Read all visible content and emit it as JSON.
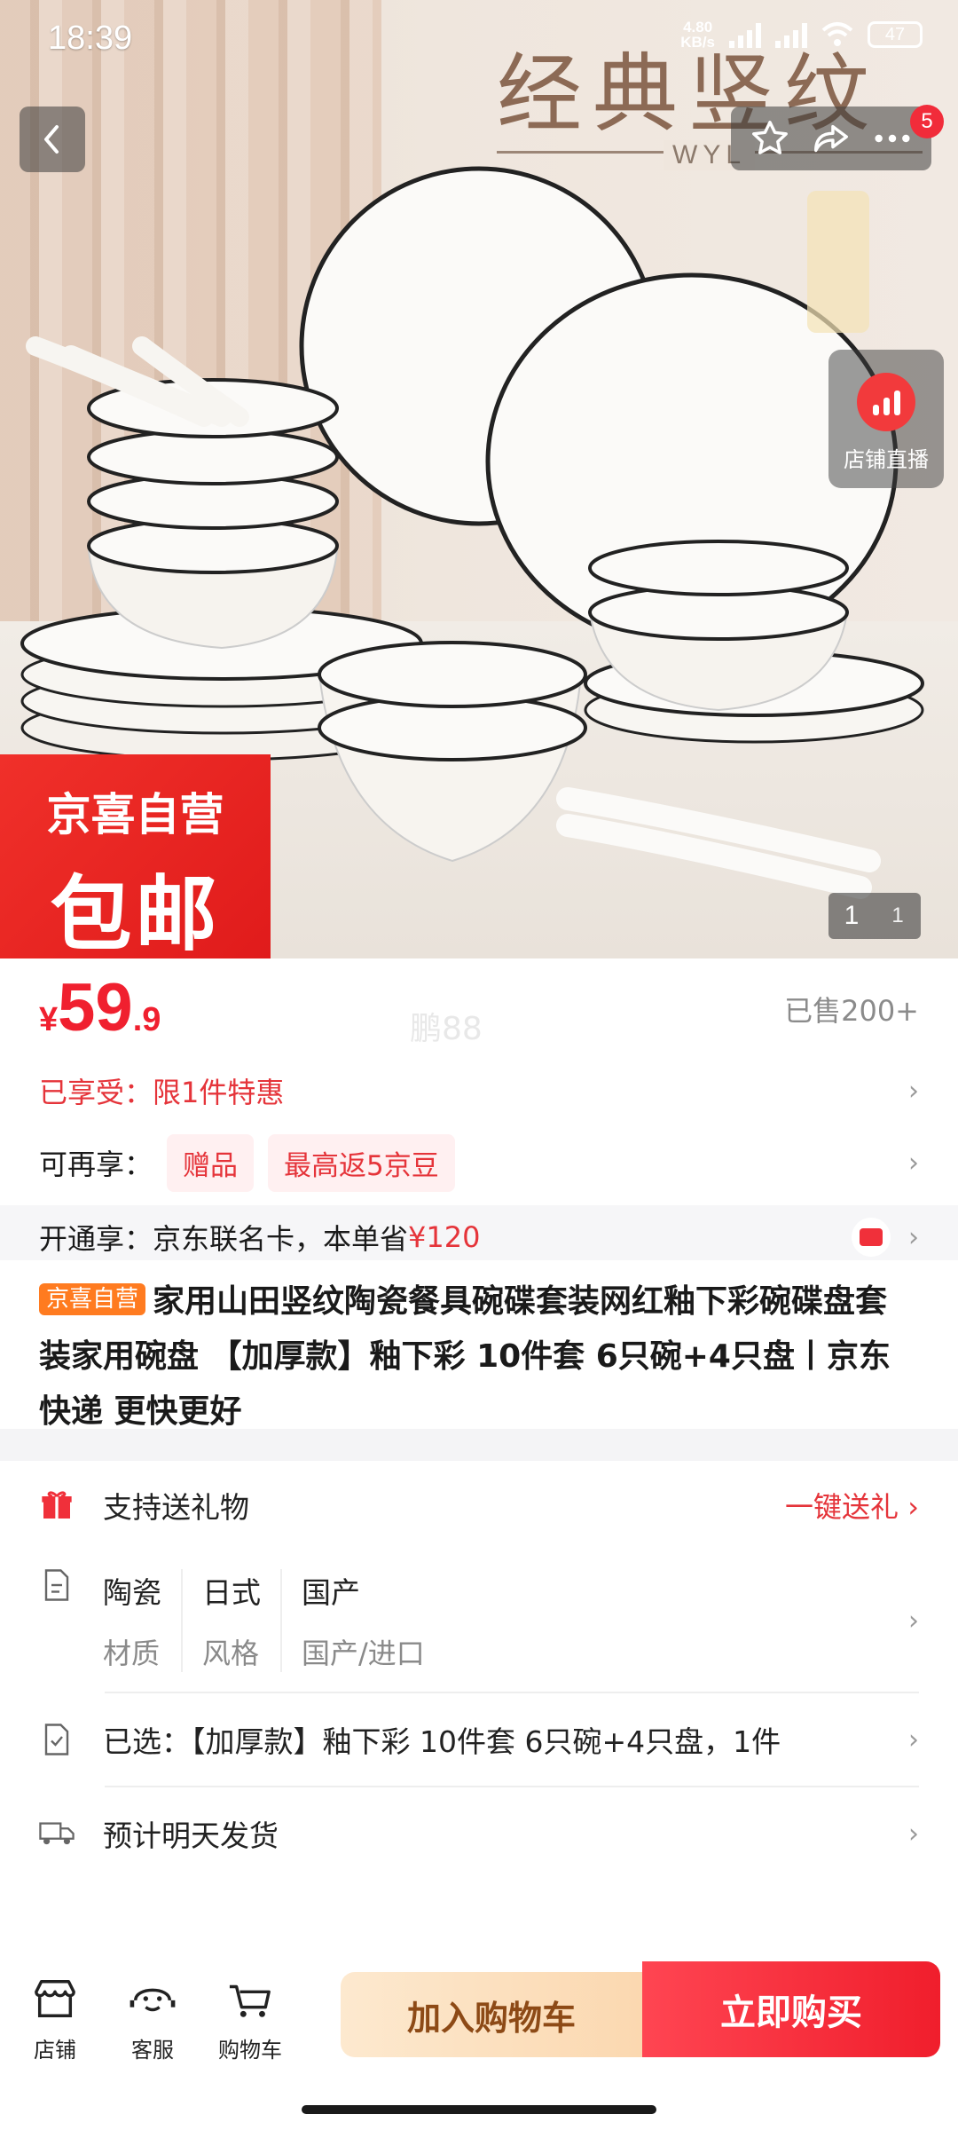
{
  "status_bar": {
    "time": "18:39",
    "net_speed": "4.80",
    "net_unit": "KB/s",
    "battery": "47"
  },
  "hero": {
    "headline": "经典竖纹",
    "subline": "WYL",
    "promo_top": "京喜自营",
    "promo_main": "包邮",
    "live_label": "店铺直播",
    "counter_current": "1",
    "counter_total": "1",
    "notif_count": "5"
  },
  "price": {
    "currency": "¥",
    "integer": "59",
    "decimal": ".9",
    "sold": "已售200+",
    "watermark": "鹏88"
  },
  "offers": {
    "enjoyed_label": "已享受：",
    "enjoyed_value": "限1件特惠",
    "more_label": "可再享：",
    "tags": [
      "赠品",
      "最高返5京豆"
    ],
    "open_label": "开通享：",
    "open_text": "京东联名卡，本单省",
    "open_amount": "¥120"
  },
  "product": {
    "badge": "京喜自营",
    "title": "家用山田竖纹陶瓷餐具碗碟套装网红釉下彩碗碟盘套装家用碗盘 【加厚款】釉下彩 10件套 6只碗+4只盘丨京东快递 更快更好"
  },
  "detail": {
    "gift_text": "支持送礼物",
    "gift_cta": "一键送礼 ›",
    "attrs": [
      {
        "value": "陶瓷",
        "key": "材质"
      },
      {
        "value": "日式",
        "key": "风格"
      },
      {
        "value": "国产",
        "key": "国产/进口"
      }
    ],
    "selected": "已选：【加厚款】釉下彩 10件套 6只碗+4只盘，1件",
    "shipping": "预计明天发货"
  },
  "bottom_bar": {
    "store": "店铺",
    "service": "客服",
    "cart": "购物车",
    "add_to_cart": "加入购物车",
    "buy_now": "立即购买"
  }
}
